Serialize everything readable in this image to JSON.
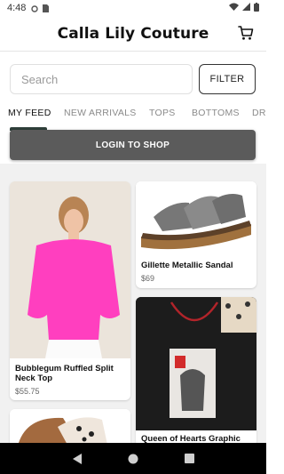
{
  "status": {
    "time": "4:48"
  },
  "app": {
    "title": "Calla Lily Couture"
  },
  "search": {
    "placeholder": "Search"
  },
  "filter_label": "FILTER",
  "tabs": [
    "MY FEED",
    "NEW ARRIVALS",
    "TOPS",
    "BOTTOMS",
    "DRE"
  ],
  "login_banner": "LOGIN TO SHOP",
  "products": [
    {
      "name": "Bubblegum Ruffled Split Neck Top",
      "price": "$55.75"
    },
    {
      "name": "Gillette Metallic Sandal",
      "price": "$69"
    },
    {
      "name": "Queen of Hearts Graphic",
      "price": ""
    },
    {
      "name": "",
      "price": ""
    }
  ],
  "colors": {
    "banner": "#5b5b5b",
    "feed_bg": "#f1f1f1",
    "pink_top": "#ff3fbf"
  }
}
